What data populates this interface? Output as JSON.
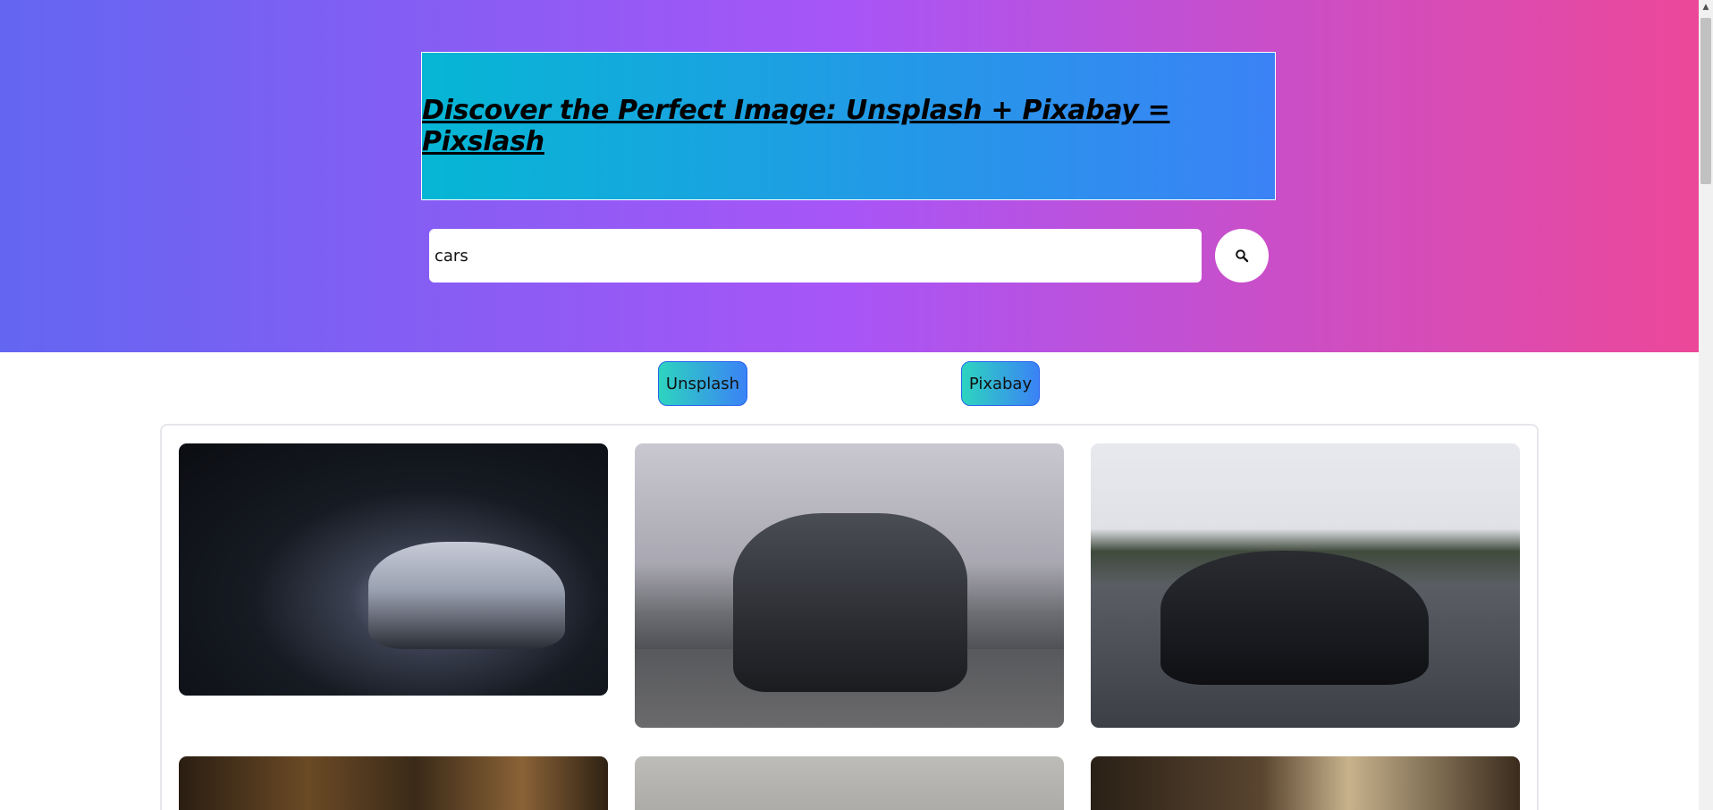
{
  "hero": {
    "title": "Discover the Perfect Image: Unsplash + Pixabay = Pixslash"
  },
  "search": {
    "value": "cars",
    "button_icon": "search-icon"
  },
  "sources": {
    "unsplash_label": "Unsplash",
    "pixabay_label": "Pixabay"
  },
  "gallery": {
    "photos": [
      {
        "subject": "white sports car in dark garage"
      },
      {
        "subject": "dark muscle car front view on road"
      },
      {
        "subject": "black sedan driving on highway"
      },
      {
        "subject": "forest photo"
      },
      {
        "subject": "room interior photo"
      },
      {
        "subject": "interior photo"
      }
    ]
  },
  "colors": {
    "hero_gradient": [
      "#6366f1",
      "#a855f7",
      "#ec4899"
    ],
    "banner_gradient": [
      "#06b6d4",
      "#3b82f6"
    ],
    "tab_gradient": [
      "#2dd4bf",
      "#3b82f6"
    ]
  }
}
